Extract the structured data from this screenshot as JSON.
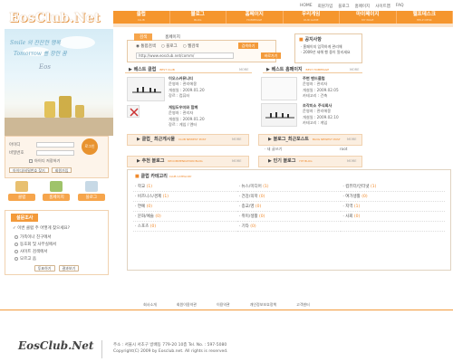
{
  "logo": "EosClub.Net",
  "top_links": [
    "HOME",
    "회원가입",
    "블로그",
    "홈페이지",
    "사이트맵",
    "FAQ"
  ],
  "nav": [
    {
      "label": "클럽",
      "sub": "CLUB"
    },
    {
      "label": "블로그",
      "sub": "BLOG"
    },
    {
      "label": "홈페이지",
      "sub": "HOMEPAGE"
    },
    {
      "label": "우리게임",
      "sub": "OUR GAME"
    },
    {
      "label": "마이페이지",
      "sub": "MY PAGE"
    },
    {
      "label": "헬프데스크",
      "sub": "HELP DESK"
    }
  ],
  "hero": {
    "line1": "Smile 의 잔잔한 행복",
    "line2": "Tomorrow 를 향한 꿈",
    "sign": "Eos"
  },
  "login": {
    "id_label": "아이디",
    "pw_label": "비밀번호",
    "remember_label": "아이디 저장하기",
    "button": "로그인",
    "find_button": "아이디/비밀번호 찾기",
    "join_button": "회원가입"
  },
  "quick": [
    "클럽",
    "홈페이지",
    "블로그"
  ],
  "poll": {
    "title": "설문조사",
    "question": "이번 클럽 주 어떻게 찾으세요?",
    "options": [
      "가족이나 친구에서",
      "동호회 및 사무실에서",
      "사이트 검색에서",
      "모르고 옴"
    ],
    "vote_button": "투표하기",
    "result_button": "결과보기"
  },
  "search": {
    "tabs": [
      "검색",
      "홈페이지"
    ],
    "radios": [
      "통합검색",
      "블로그",
      "웹검색"
    ],
    "value": "http://www.eosclub.net/comm/",
    "button1": "검색하기",
    "button2": "바로가기"
  },
  "notice": {
    "title": "공지사항",
    "items": [
      "· 홈페이지 입학하게 관리해",
      "· 2009년 세해 행 중이 알리세요"
    ]
  },
  "best_club": {
    "title": "베스트 클럽",
    "en": "BEST CLUB",
    "more": "MORE",
    "items": [
      {
        "name": "이오스커뮤니티",
        "owner": "운영자 : 관리에몽",
        "date": "개설일 : 2009.01.20",
        "cat": "장르 : 컴퓨터"
      },
      {
        "name": "게임도우미와 함께",
        "owner": "운영자 : 관리자",
        "date": "개설일 : 2009.01.20",
        "cat": "장르 : 게임 / 엔터"
      }
    ]
  },
  "best_homepage": {
    "title": "베스트 홈페이지",
    "en": "BEST HOMEPAGE",
    "more": "MORE",
    "items": [
      {
        "name": "주변 밴드클럽",
        "owner": "운영자 : 관리자",
        "date": "개설일 : 2009.02.05",
        "cat": "카테고리 : 건축"
      },
      {
        "name": "조각미소 주식회사",
        "owner": "운영자 : 관리에몽",
        "date": "개설일 : 2009.02.10",
        "cat": "카테고리 : 게임"
      }
    ]
  },
  "club_latest": {
    "title": "클럽_ 최근게시물",
    "en": "CLUB NEWEST POST",
    "more": "MORE"
  },
  "blog_latest": {
    "title": "블로그_최근포스트",
    "en": "BLOG NEWEST POST",
    "more": "MORE",
    "item": "새 글쓰기",
    "author": "root"
  },
  "rec_blog": {
    "title": "추천 블로그",
    "en": "RECOMMENDATION BLOG",
    "more": "MORE"
  },
  "pop_blog": {
    "title": "인기 블로그",
    "en": "HIT BLOG",
    "more": "MORE"
  },
  "category": {
    "title": "클럽 카테고리",
    "en": "CLUB CATEGORY",
    "items": [
      {
        "name": "학교",
        "count": "(1)"
      },
      {
        "name": "뉴스/미디어",
        "count": "(1)"
      },
      {
        "name": "컴퓨터/인터넷",
        "count": "(1)"
      },
      {
        "name": "비즈니스/경제",
        "count": "(1)"
      },
      {
        "name": "건강/의학",
        "count": "(0)"
      },
      {
        "name": "여가생활",
        "count": "(0)"
      },
      {
        "name": "연예",
        "count": "(0)"
      },
      {
        "name": "종교/영",
        "count": "(0)"
      },
      {
        "name": "지역",
        "count": "(1)"
      },
      {
        "name": "문화/예술",
        "count": "(0)"
      },
      {
        "name": "취미/생활",
        "count": "(0)"
      },
      {
        "name": "사회",
        "count": "(0)"
      },
      {
        "name": "스포츠",
        "count": "(0)"
      },
      {
        "name": "기타",
        "count": "(0)"
      },
      {
        "name": "",
        "count": ""
      }
    ]
  },
  "footer": {
    "links": [
      "회사소개",
      "회원이용약관",
      "이용약관",
      "개인정보보호정책",
      "고객센터"
    ],
    "logo": "EosClub.Net",
    "address": "주소 : 서울시 서초구 방배동 779-20 10층    Tel. No. : 597-5080",
    "copyright": "Copyright(C) 2009  by Eosclub.net.      All rights is reserved."
  }
}
